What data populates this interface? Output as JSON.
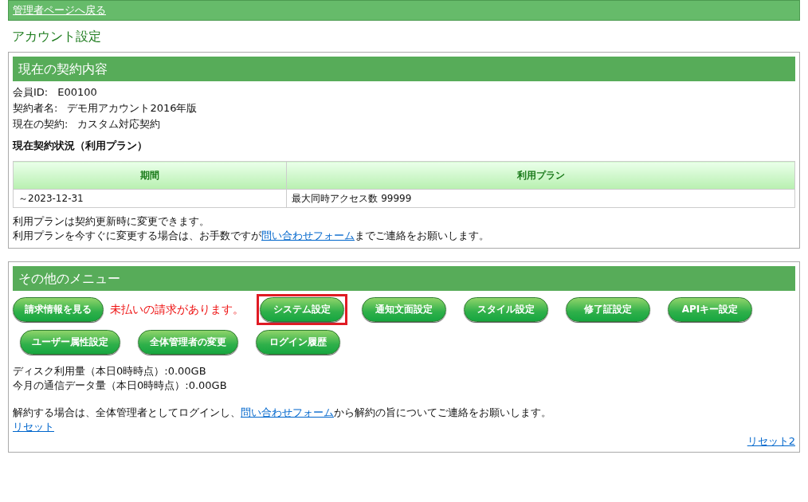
{
  "top_bar": {
    "back_link": "管理者ページへ戻る"
  },
  "page_title": "アカウント設定",
  "contract": {
    "heading": "現在の契約内容",
    "fields": [
      {
        "label": "会員ID:",
        "value": "E00100"
      },
      {
        "label": "契約者名:",
        "value": "デモ用アカウント2016年版"
      },
      {
        "label": "現在の契約:",
        "value": "カスタム対応契約"
      }
    ],
    "status_heading": "現在契約状況（利用プラン）",
    "table": {
      "columns": [
        "期間",
        "利用プラン"
      ],
      "rows": [
        [
          "～2023-12-31",
          "最大同時アクセス数 99999"
        ]
      ]
    },
    "note_1": "利用プランは契約更新時に変更できます。",
    "note_2": {
      "before": "利用プランを今すぐに変更する場合は、お手数ですが",
      "link": "問い合わせフォーム",
      "after": "までご連絡をお願いします。"
    }
  },
  "other_menu": {
    "heading": "その他のメニュー",
    "rows": [
      [
        {
          "kind": "button",
          "label": "請求情報を見る",
          "highlighted": false
        },
        {
          "kind": "notice",
          "label": "未払いの請求があります。"
        },
        {
          "kind": "button",
          "label": "システム設定",
          "highlighted": true
        },
        {
          "kind": "button",
          "label": "通知文面設定",
          "highlighted": false
        },
        {
          "kind": "button",
          "label": "スタイル設定",
          "highlighted": false
        },
        {
          "kind": "button",
          "label": "修了証設定",
          "highlighted": false
        },
        {
          "kind": "button",
          "label": "APIキー設定",
          "highlighted": false
        }
      ],
      [
        {
          "kind": "button",
          "label": "ユーザー属性設定",
          "highlighted": false
        },
        {
          "kind": "button",
          "label": "全体管理者の変更",
          "highlighted": false
        },
        {
          "kind": "button",
          "label": "ログイン履歴",
          "highlighted": false
        }
      ]
    ],
    "usage": [
      "ディスク利用量（本日0時時点）:0.00GB",
      "今月の通信データ量（本日0時時点）:0.00GB"
    ],
    "cancel_note": {
      "before": "解約する場合は、全体管理者としてログインし、",
      "link": "問い合わせフォーム",
      "after": "から解約の旨についてご連絡をお願いします。"
    },
    "reset_link": "リセット",
    "reset2_link": "リセット2"
  }
}
